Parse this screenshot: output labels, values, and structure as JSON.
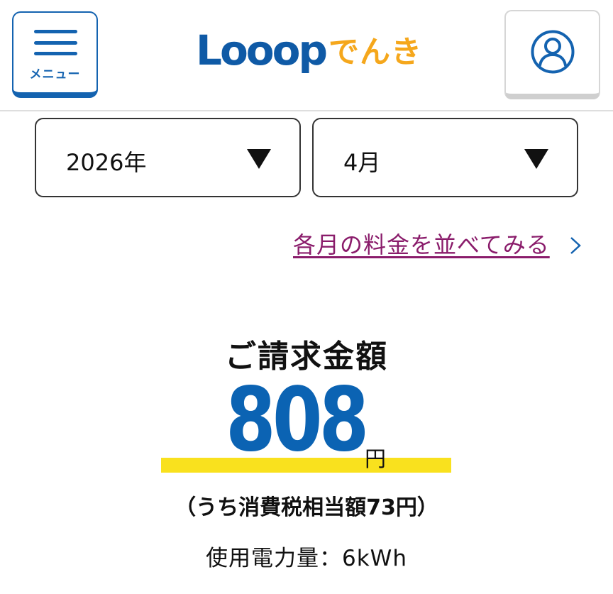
{
  "header": {
    "menu_label": "メニュー",
    "logo_latin": "Looop",
    "logo_jp": "でんき",
    "logo_colors": {
      "latin": "#0f5aa6",
      "jp": "#f5a71c"
    },
    "menu_icon": "hamburger-icon",
    "account_icon": "user-icon"
  },
  "filters": {
    "year_value": "2026年",
    "month_value": "4月",
    "dropdown_icon": "triangle-down-icon"
  },
  "compare": {
    "link_text": "各月の料金を並べてみる",
    "icon": "chevron-right-icon",
    "link_color": "#8a1c6b"
  },
  "billing": {
    "title": "ご請求金額",
    "amount": "808",
    "currency": "円",
    "tax_note": "（うち消費税相当額73円）",
    "usage": "使用電力量：6kWh",
    "accent_color": "#0b63b3",
    "highlight_color": "#f9e11e"
  }
}
